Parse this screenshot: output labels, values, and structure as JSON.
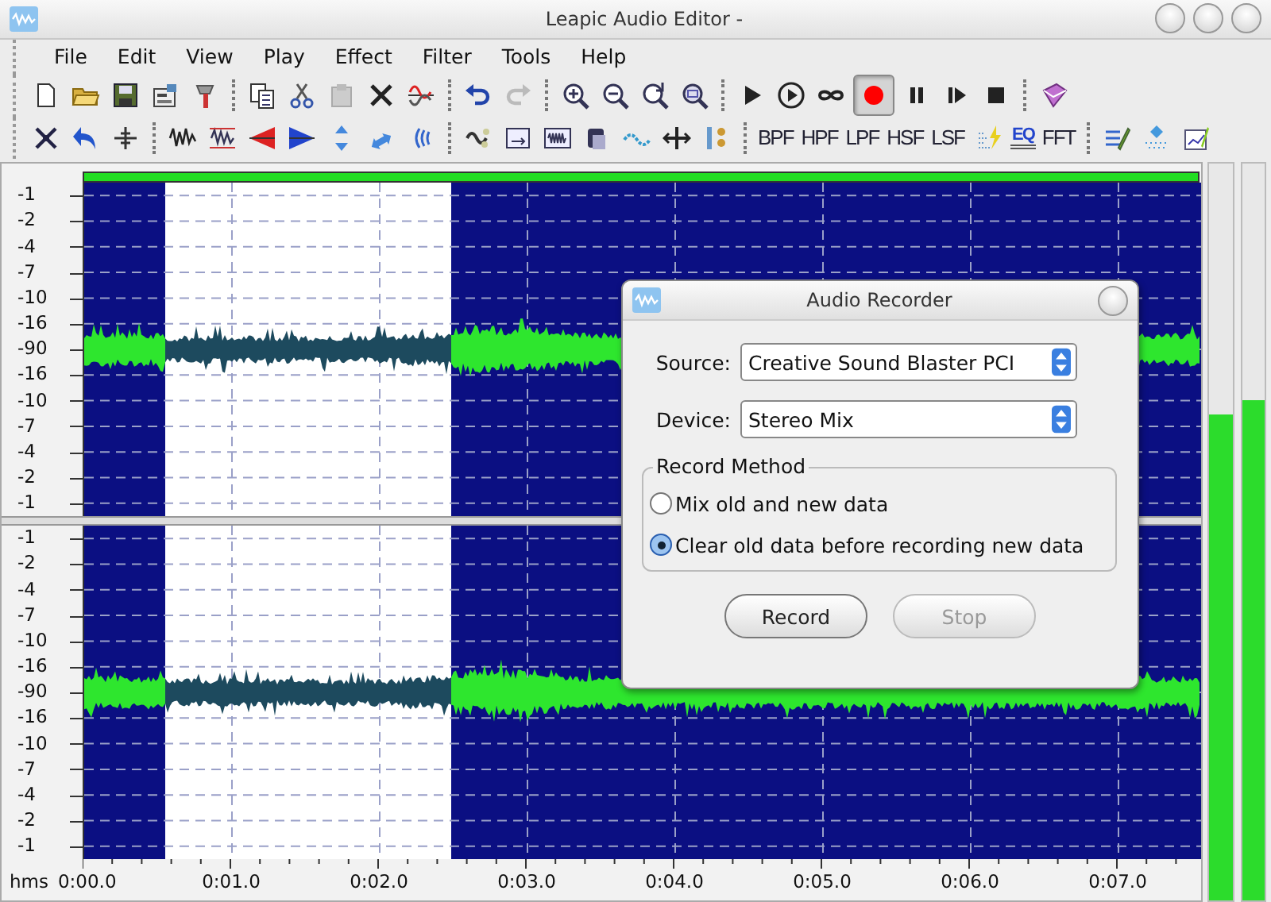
{
  "window": {
    "title": "Leapic Audio Editor -"
  },
  "menu": [
    "File",
    "Edit",
    "View",
    "Play",
    "Effect",
    "Filter",
    "Tools",
    "Help"
  ],
  "toolbar": {
    "record_pressed": true
  },
  "filter_buttons": [
    "BPF",
    "HPF",
    "LPF",
    "HSF",
    "LSF"
  ],
  "eq_label": "EQ",
  "fft_label": "FFT",
  "channels": [
    {
      "scale": [
        "-1",
        "-2",
        "-4",
        "-7",
        "-10",
        "-16",
        "-90",
        "-16",
        "-10",
        "-7",
        "-4",
        "-2",
        "-1"
      ]
    },
    {
      "scale": [
        "-1",
        "-2",
        "-4",
        "-7",
        "-10",
        "-16",
        "-90",
        "-16",
        "-10",
        "-7",
        "-4",
        "-2",
        "-1"
      ]
    }
  ],
  "time_axis": {
    "unit": "hms",
    "ticks": [
      "0:00.0",
      "0:01.0",
      "0:02.0",
      "0:03.0",
      "0:04.0",
      "0:05.0",
      "0:06.0",
      "0:07.0"
    ]
  },
  "meters": [
    {
      "level": 0.66
    },
    {
      "level": 0.68
    }
  ],
  "dialog": {
    "title": "Audio Recorder",
    "source": {
      "label": "Source:",
      "value": "Creative Sound Blaster PCI"
    },
    "device": {
      "label": "Device:",
      "value": "Stereo Mix"
    },
    "record_method": {
      "title": "Record Method",
      "options": [
        {
          "label": "Mix old and new data",
          "selected": false
        },
        {
          "label": "Clear old data before recording new data",
          "selected": true
        }
      ]
    },
    "buttons": [
      {
        "label": "Record",
        "disabled": false
      },
      {
        "label": "Stop",
        "disabled": true
      }
    ]
  }
}
